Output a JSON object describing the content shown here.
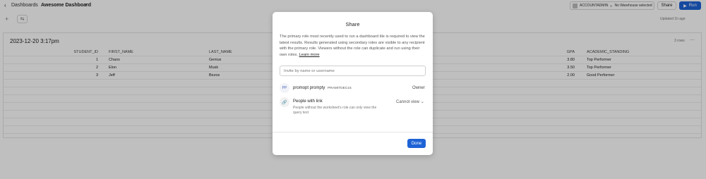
{
  "header": {
    "back_icon": "chevron-left-icon",
    "breadcrumb": "Dashboards",
    "dashboard_title": "Awesome Dashboard",
    "role": "ACCOUNTADMIN",
    "warehouse": "No Warehouse selected",
    "share_label": "Share",
    "run_label": "Run"
  },
  "toolbar": {
    "updated": "Updated 1h ago"
  },
  "panel": {
    "title": "2023-12-20 3:17pm",
    "row_count": "3 rows",
    "columns": [
      "STUDENT_ID",
      "FIRST_NAME",
      "LAST_NAME",
      "GPA",
      "ACADEMIC_STANDING"
    ],
    "rows": [
      [
        "1",
        "Chaos",
        "Genius",
        "3.80",
        "Top Performer"
      ],
      [
        "2",
        "Elon",
        "Musk",
        "3.50",
        "Top Performer"
      ],
      [
        "3",
        "Jeff",
        "Bezos",
        "2.00",
        "Good Performer"
      ]
    ]
  },
  "modal": {
    "title": "Share",
    "description": "The primary role most recently used to run a dashboard tile is required to view the latest results. Results generated using secondary roles are visible to any recipient with the primary role. Viewers without the role can duplicate and run using their own roles.",
    "learn_more": "Learn more",
    "invite_placeholder": "Invite by name or username",
    "user": {
      "initials": "PP",
      "name": "promopt prompty",
      "id": "PRAMITDEC15",
      "permission": "Owner"
    },
    "link": {
      "label": "People with link",
      "sub": "People without the worksheet's role can only view the query text",
      "permission": "Cannot view"
    },
    "done_label": "Done"
  },
  "colors": {
    "accent": "#1e63d6",
    "overlay": "rgba(0,0,0,0.25)"
  }
}
